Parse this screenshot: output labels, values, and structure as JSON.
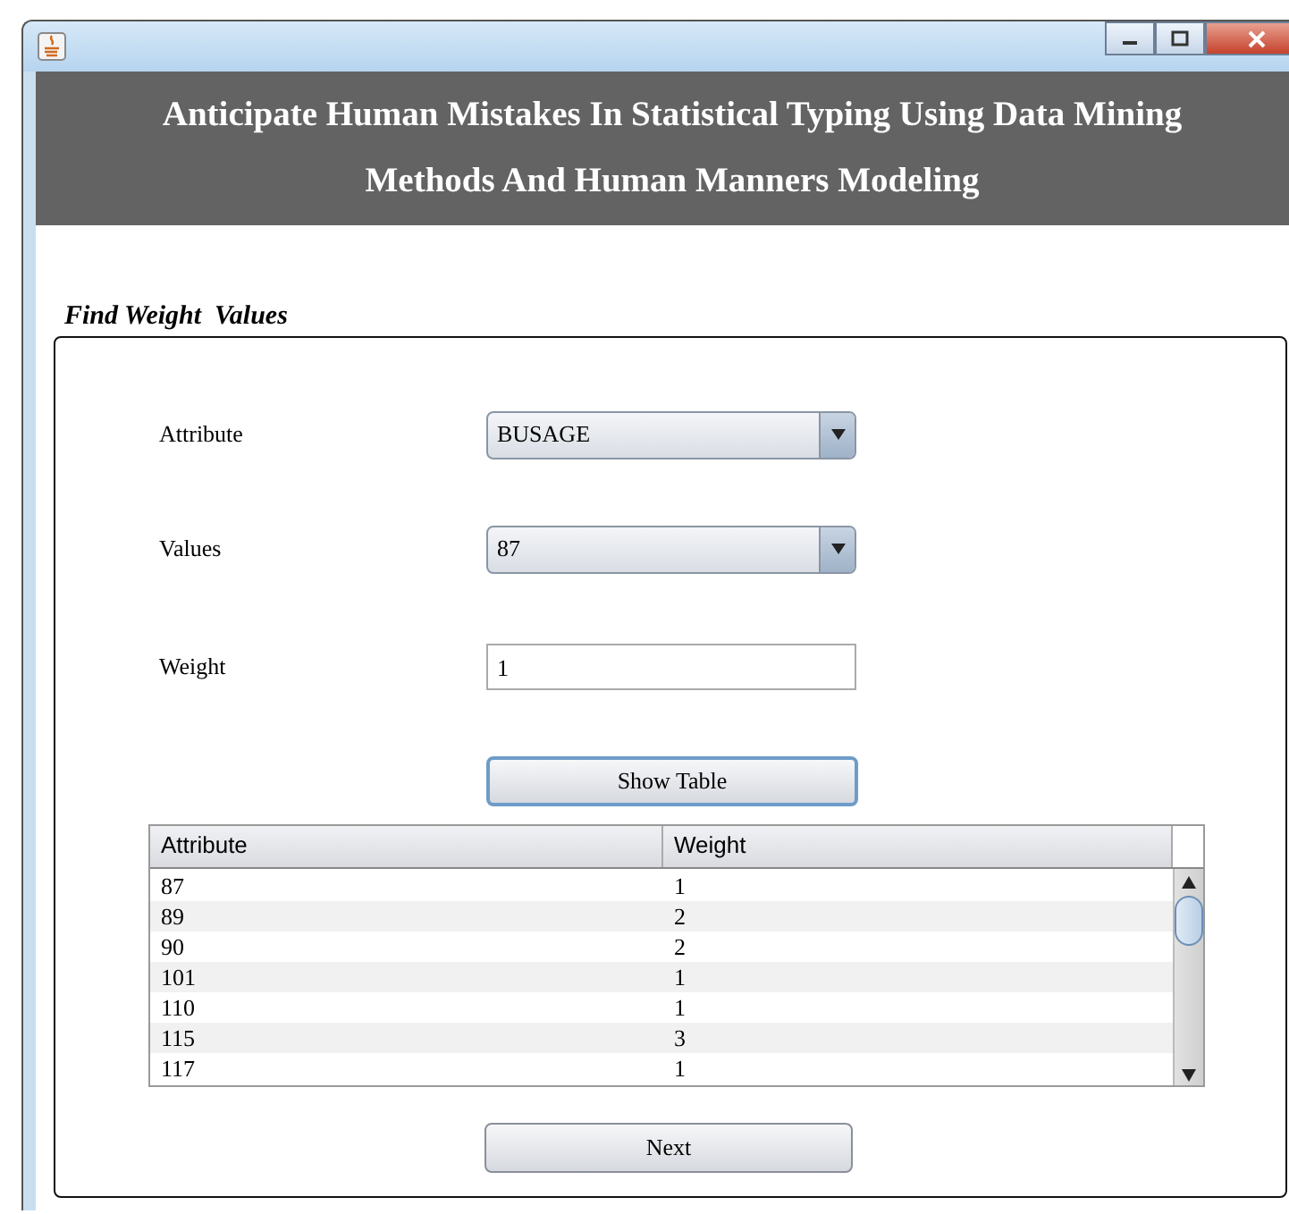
{
  "window": {
    "title_lines": [
      "Anticipate Human Mistakes In Statistical Typing Using Data Mining",
      "Methods And Human Manners Modeling"
    ]
  },
  "section": {
    "title": "Find Weight  Values"
  },
  "form": [
    {
      "kind": "combo",
      "label": "Attribute",
      "value": "BUSAGE"
    },
    {
      "kind": "combo",
      "label": "Values",
      "value": "87"
    },
    {
      "kind": "text",
      "label": "Weight",
      "value": "1"
    }
  ],
  "show_button": {
    "label": "Show Table",
    "focused": true
  },
  "table": {
    "columns": [
      "Attribute",
      "Weight"
    ],
    "rows": [
      [
        "87",
        "1"
      ],
      [
        "89",
        "2"
      ],
      [
        "90",
        "2"
      ],
      [
        "101",
        "1"
      ],
      [
        "110",
        "1"
      ],
      [
        "115",
        "3"
      ],
      [
        "117",
        "1"
      ]
    ]
  },
  "next_button": {
    "label": "Next"
  }
}
